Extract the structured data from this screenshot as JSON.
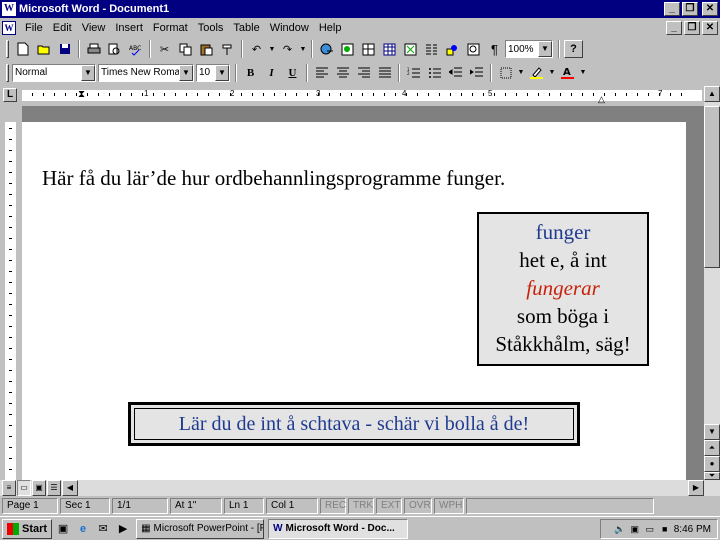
{
  "window": {
    "title": "Microsoft Word - Document1",
    "minimize": "_",
    "restore": "❐",
    "close": "✕"
  },
  "menu": {
    "items": [
      "File",
      "Edit",
      "View",
      "Insert",
      "Format",
      "Tools",
      "Table",
      "Window",
      "Help"
    ],
    "doc_min": "_",
    "doc_restore": "❐",
    "doc_close": "✕"
  },
  "standard_toolbar": {
    "zoom": "100%",
    "help": "?"
  },
  "formatting_toolbar": {
    "style": "Normal",
    "font": "Times New Roman",
    "size": "10",
    "bold": "B",
    "italic": "I",
    "underline": "U"
  },
  "ruler": {
    "numbers": [
      "1",
      "2",
      "3",
      "4",
      "5",
      "7"
    ]
  },
  "document": {
    "body_text": "Här få du lär’de hur ordbehannlingsprogramme funger.",
    "callout_lines": [
      "funger",
      "het e, å int",
      "fungerar",
      "som böga i",
      "Ståkkhålm, säg!"
    ],
    "banner_text": "Lär du de int å schtava - schär vi bolla å de!"
  },
  "status": {
    "page": "Page 1",
    "sec": "Sec 1",
    "pages": "1/1",
    "at": "At 1\"",
    "ln": "Ln 1",
    "col": "Col 1",
    "modes": [
      "REC",
      "TRK",
      "EXT",
      "OVR",
      "WPH"
    ]
  },
  "taskbar": {
    "start": "Start",
    "tasks": [
      "Microsoft PowerPoint - [Fe...",
      "Microsoft Word - Doc..."
    ],
    "clock": "8:46 PM"
  },
  "colors": {
    "title_bar": "#000080",
    "blue_text": "#1f3b8f",
    "red_text": "#c8220a"
  }
}
